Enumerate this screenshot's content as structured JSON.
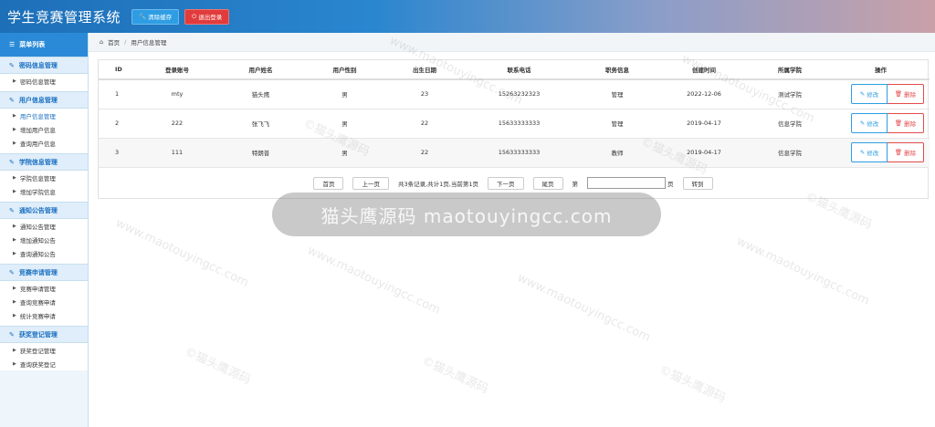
{
  "header": {
    "title": "学生竞赛管理系统",
    "clear_cache_label": "清除缓存",
    "logout_label": "退出登录"
  },
  "sidebar": {
    "menu_title": "菜单列表",
    "groups": [
      {
        "label": "密码信息管理",
        "items": [
          "密码信息管理"
        ]
      },
      {
        "label": "用户信息管理",
        "items": [
          "用户信息管理",
          "增加用户信息",
          "查询用户信息"
        ]
      },
      {
        "label": "学院信息管理",
        "items": [
          "学院信息管理",
          "增加学院信息"
        ]
      },
      {
        "label": "通知公告管理",
        "items": [
          "通知公告管理",
          "增加通知公告",
          "查询通知公告"
        ]
      },
      {
        "label": "竞赛申请管理",
        "items": [
          "竞赛申请管理",
          "查询竞赛申请",
          "统计竞赛申请"
        ]
      },
      {
        "label": "获奖登记管理",
        "items": [
          "获奖登记管理",
          "查询获奖登记"
        ]
      }
    ]
  },
  "breadcrumb": {
    "home": "首页",
    "current": "用户信息管理"
  },
  "table": {
    "headers": [
      "ID",
      "登录账号",
      "用户姓名",
      "用户性别",
      "出生日期",
      "联系电话",
      "职务信息",
      "创建时间",
      "所属学院",
      "操作"
    ],
    "rows": [
      [
        "1",
        "mty",
        "猫头鹰",
        "男",
        "23",
        "15263232323",
        "管理",
        "2022-12-06",
        "测试学院"
      ],
      [
        "2",
        "222",
        "张飞飞",
        "男",
        "22",
        "15633333333",
        "管理",
        "2019-04-17",
        "信息学院"
      ],
      [
        "3",
        "111",
        "特朗普",
        "男",
        "22",
        "15633333333",
        "教师",
        "2019-04-17",
        "信息学院"
      ]
    ],
    "edit_label": "修改",
    "delete_label": "删除"
  },
  "pager": {
    "first": "首页",
    "prev": "上一页",
    "info": "共3条记录,共计1页,当前第1页",
    "next": "下一页",
    "last": "尾页",
    "page_prefix": "第",
    "page_suffix": "页",
    "go": "转到"
  },
  "watermark": {
    "text_cn": "©猫头鹰源码",
    "text_url": "www.maotouyingcc.com",
    "pill": "猫头鹰源码 maotouyingcc.com"
  }
}
